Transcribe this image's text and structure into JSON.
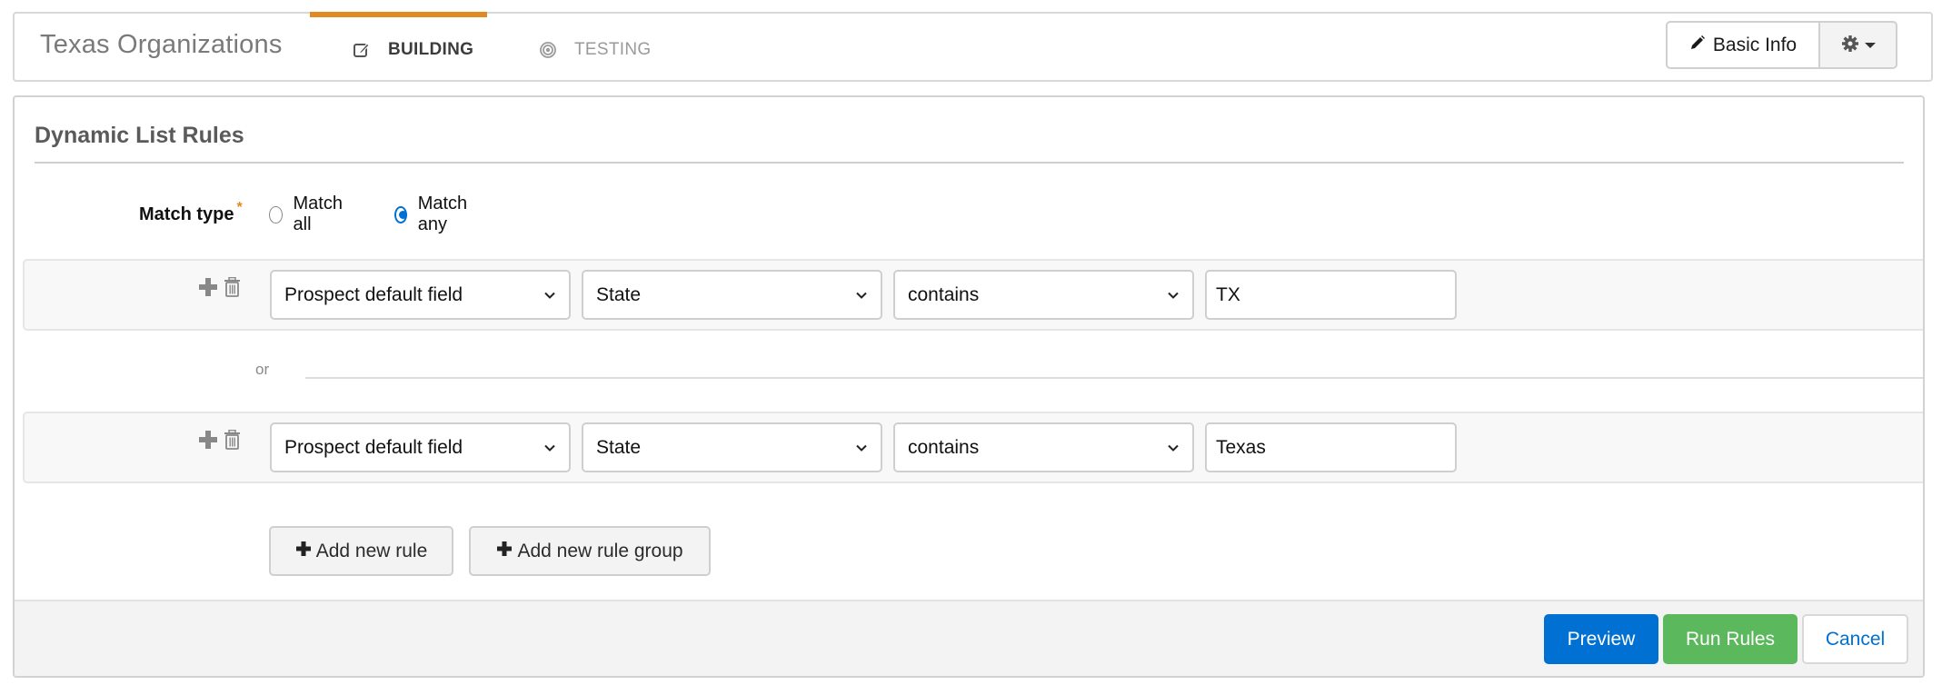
{
  "header": {
    "title": "Texas Organizations",
    "tabs": [
      {
        "label": "BUILDING",
        "icon": "edit-icon",
        "active": true
      },
      {
        "label": "TESTING",
        "icon": "target-icon",
        "active": false
      }
    ],
    "basic_info_label": "Basic Info",
    "basic_info_icon": "pencil-icon",
    "settings_icon": "gear-icon"
  },
  "panel": {
    "title": "Dynamic List Rules",
    "match_type": {
      "label": "Match type",
      "required_marker": "*",
      "options": [
        {
          "label": "Match all",
          "checked": false
        },
        {
          "label": "Match any",
          "checked": true
        }
      ]
    },
    "rules": [
      {
        "field_type": "Prospect default field",
        "field": "State",
        "operator": "contains",
        "value": "TX"
      },
      {
        "field_type": "Prospect default field",
        "field": "State",
        "operator": "contains",
        "value": "Texas"
      }
    ],
    "separator_label": "or",
    "add_rule_label": "Add new rule",
    "add_rule_group_label": "Add new rule group"
  },
  "footer": {
    "preview_label": "Preview",
    "run_rules_label": "Run Rules",
    "cancel_label": "Cancel"
  },
  "colors": {
    "accent_tab": "#e08a22",
    "primary": "#0070d2",
    "success": "#5cb85c",
    "required": "#e08a22"
  }
}
